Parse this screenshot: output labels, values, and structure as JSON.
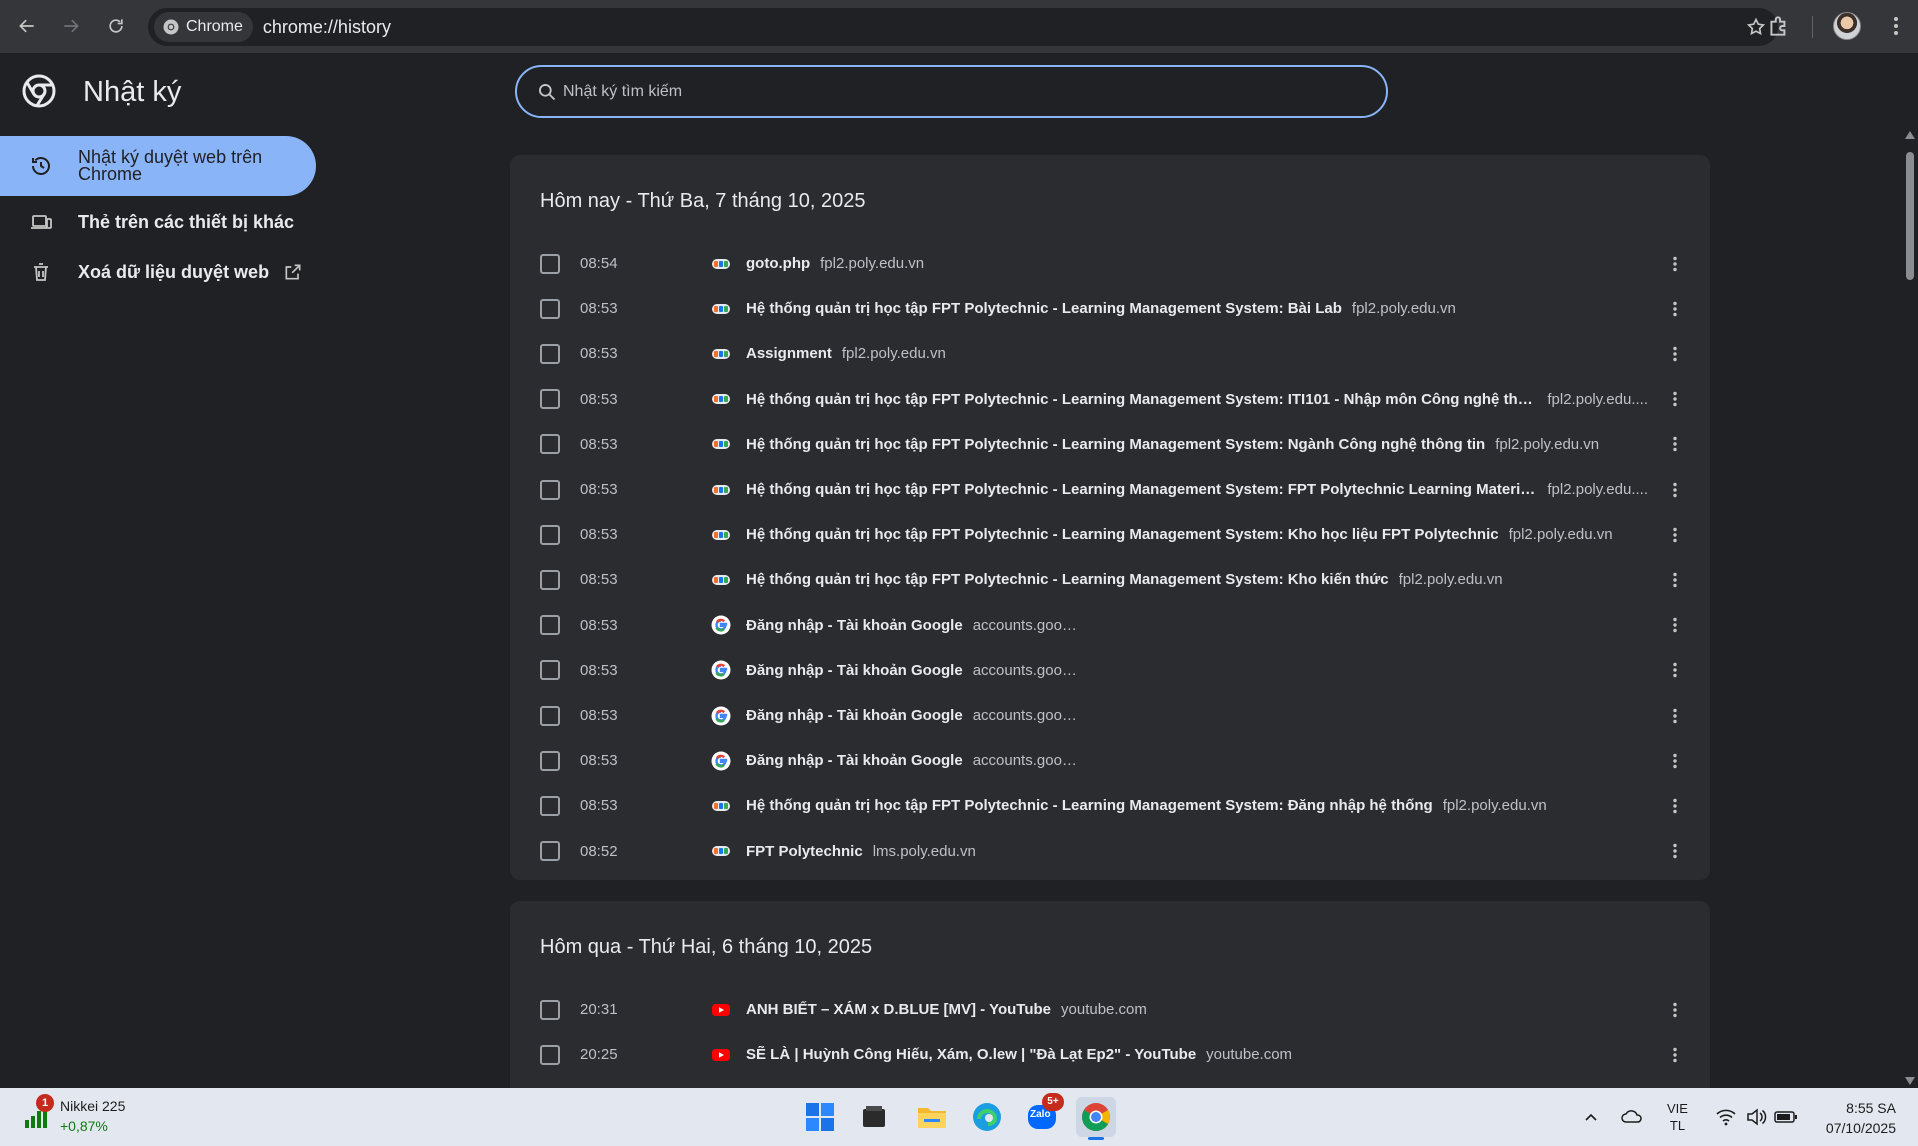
{
  "browser": {
    "chip_label": "Chrome",
    "url": "chrome://history"
  },
  "header": {
    "title": "Nhật ký",
    "search_placeholder": "Nhật ký tìm kiếm"
  },
  "sidebar": {
    "items": [
      {
        "label": "Nhật ký duyệt web trên Chrome",
        "icon": "history-icon",
        "active": true
      },
      {
        "label": "Thẻ trên các thiết bị khác",
        "icon": "devices-icon",
        "active": false
      },
      {
        "label": "Xoá dữ liệu duyệt web",
        "icon": "trash-icon",
        "active": false
      }
    ]
  },
  "history": {
    "today": {
      "heading": "Hôm nay - Thứ Ba, 7 tháng 10, 2025",
      "entries": [
        {
          "time": "08:54",
          "title": "goto.php",
          "domain": "fpl2.poly.edu.vn",
          "favicon": "fpt"
        },
        {
          "time": "08:53",
          "title": "Hệ thống quản trị học tập FPT Polytechnic - Learning Management System: Bài Lab",
          "domain": "fpl2.poly.edu.vn",
          "favicon": "fpt"
        },
        {
          "time": "08:53",
          "title": "Assignment",
          "domain": "fpl2.poly.edu.vn",
          "favicon": "fpt"
        },
        {
          "time": "08:53",
          "title": "Hệ thống quản trị học tập FPT Polytechnic - Learning Management System: ITI101 - Nhập môn Công nghệ thông ...",
          "domain": "fpl2.poly.edu....",
          "favicon": "fpt"
        },
        {
          "time": "08:53",
          "title": "Hệ thống quản trị học tập FPT Polytechnic - Learning Management System: Ngành Công nghệ thông tin",
          "domain": "fpl2.poly.edu.vn",
          "favicon": "fpt"
        },
        {
          "time": "08:53",
          "title": "Hệ thống quản trị học tập FPT Polytechnic - Learning Management System: FPT Polytechnic Learning Materials - ...",
          "domain": "fpl2.poly.edu....",
          "favicon": "fpt"
        },
        {
          "time": "08:53",
          "title": "Hệ thống quản trị học tập FPT Polytechnic - Learning Management System: Kho học liệu FPT Polytechnic",
          "domain": "fpl2.poly.edu.vn",
          "favicon": "fpt"
        },
        {
          "time": "08:53",
          "title": "Hệ thống quản trị học tập FPT Polytechnic - Learning Management System: Kho kiến thức",
          "domain": "fpl2.poly.edu.vn",
          "favicon": "fpt"
        },
        {
          "time": "08:53",
          "title": "Đăng nhập - Tài khoản Google",
          "domain": "accounts.google.com",
          "favicon": "google"
        },
        {
          "time": "08:53",
          "title": "Đăng nhập - Tài khoản Google",
          "domain": "accounts.google.com",
          "favicon": "google"
        },
        {
          "time": "08:53",
          "title": "Đăng nhập - Tài khoản Google",
          "domain": "accounts.google.com",
          "favicon": "google"
        },
        {
          "time": "08:53",
          "title": "Đăng nhập - Tài khoản Google",
          "domain": "accounts.google.com",
          "favicon": "google"
        },
        {
          "time": "08:53",
          "title": "Hệ thống quản trị học tập FPT Polytechnic - Learning Management System: Đăng nhập hệ thống",
          "domain": "fpl2.poly.edu.vn",
          "favicon": "fpt"
        },
        {
          "time": "08:52",
          "title": "FPT Polytechnic",
          "domain": "lms.poly.edu.vn",
          "favicon": "fpt"
        }
      ]
    },
    "yesterday": {
      "heading": "Hôm qua - Thứ Hai, 6 tháng 10, 2025",
      "entries": [
        {
          "time": "20:31",
          "title": "ANH BIẾT – XÁM x D.BLUE [MV] - YouTube",
          "domain": "youtube.com",
          "favicon": "youtube"
        },
        {
          "time": "20:25",
          "title": "SẼ LÀ | Huỳnh Công Hiếu, Xám, O.lew | \"Đà Lạt Ep2\" - YouTube",
          "domain": "youtube.com",
          "favicon": "youtube"
        }
      ]
    }
  },
  "taskbar": {
    "stock_name": "Nikkei 225",
    "stock_change": "+0,87%",
    "stock_badge": "1",
    "zalo_label": "Zalo",
    "zalo_badge": "5+",
    "lang_line1": "VIE",
    "lang_line2": "TL",
    "time": "8:55 SA",
    "date": "07/10/2025"
  },
  "colors": {
    "accent": "#8ab4f8",
    "background": "#202124",
    "card": "#2b2c2f"
  }
}
